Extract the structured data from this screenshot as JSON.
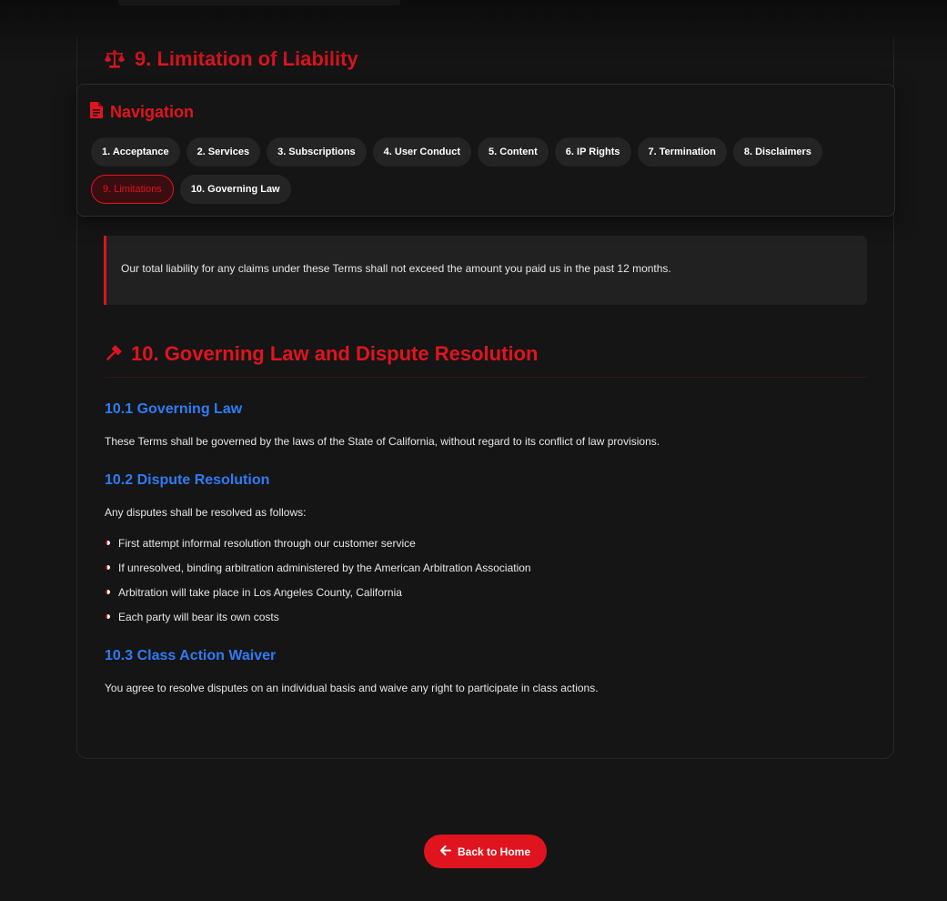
{
  "section9": {
    "heading": "9. Limitation of Liability",
    "callout": "Our total liability for any claims under these Terms shall not exceed the amount you paid us in the past 12 months."
  },
  "section10": {
    "heading": "10. Governing Law and Dispute Resolution",
    "sub1": {
      "heading": "10.1 Governing Law",
      "text": "These Terms shall be governed by the laws of the State of California, without regard to its conflict of law provisions."
    },
    "sub2": {
      "heading": "10.2 Dispute Resolution",
      "intro": "Any disputes shall be resolved as follows:",
      "bullets": [
        "First attempt informal resolution through our customer service",
        "If unresolved, binding arbitration administered by the American Arbitration Association",
        "Arbitration will take place in Los Angeles County, California",
        "Each party will bear its own costs"
      ]
    },
    "sub3": {
      "heading": "10.3 Class Action Waiver",
      "text": "You agree to resolve disputes on an individual basis and waive any right to participate in class actions."
    }
  },
  "navigation": {
    "title": "Navigation",
    "active_index": 8,
    "items": [
      "1. Acceptance",
      "2. Services",
      "3. Subscriptions",
      "4. User Conduct",
      "5. Content",
      "6. IP Rights",
      "7. Termination",
      "8. Disclaimers",
      "9. Limitations",
      "10. Governing Law"
    ]
  },
  "back_button": {
    "label": "Back to Home"
  },
  "icons": {
    "section9": "scale-icon",
    "section10": "gavel-icon",
    "navigation": "document-icon",
    "back": "arrow-left-icon"
  },
  "colors": {
    "accent": "#e0141e",
    "subheading": "#2f7bf5",
    "background": "#151515",
    "pill": "#242424"
  }
}
